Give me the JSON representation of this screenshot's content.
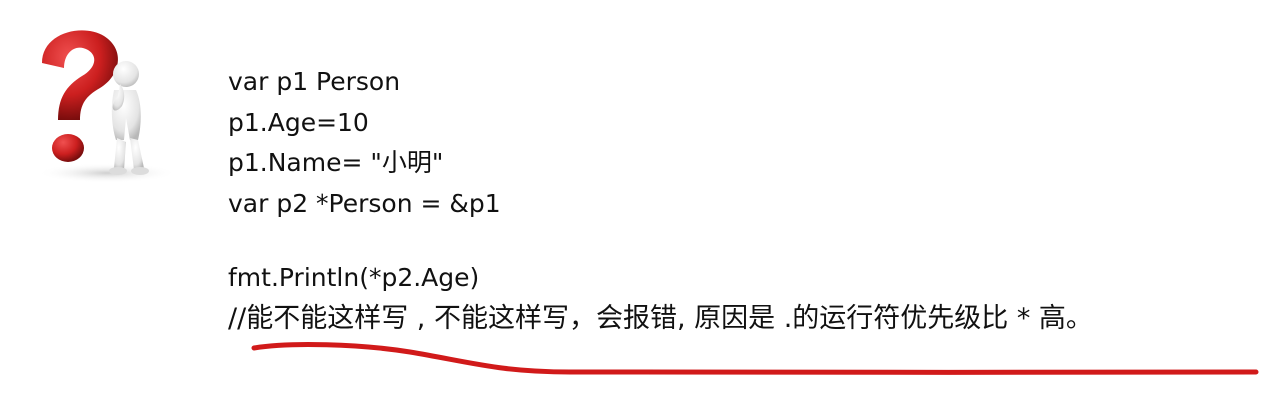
{
  "code": {
    "lines": [
      "var p1 Person",
      "p1.Age=10",
      "p1.Name= \"小明\"",
      "var p2 *Person = &p1",
      "",
      "fmt.Println(*p2.Age)"
    ],
    "comment": "//能不能这样写 , 不能这样写，会报错, 原因是 .的运行符优先级比 * 高。"
  },
  "icons": {
    "illustration": "question-mark-thinker-icon"
  },
  "colors": {
    "question_mark": "#cc1f1f",
    "figure": "#e8e8e8",
    "underline": "#d11a1a",
    "text": "#111111"
  }
}
